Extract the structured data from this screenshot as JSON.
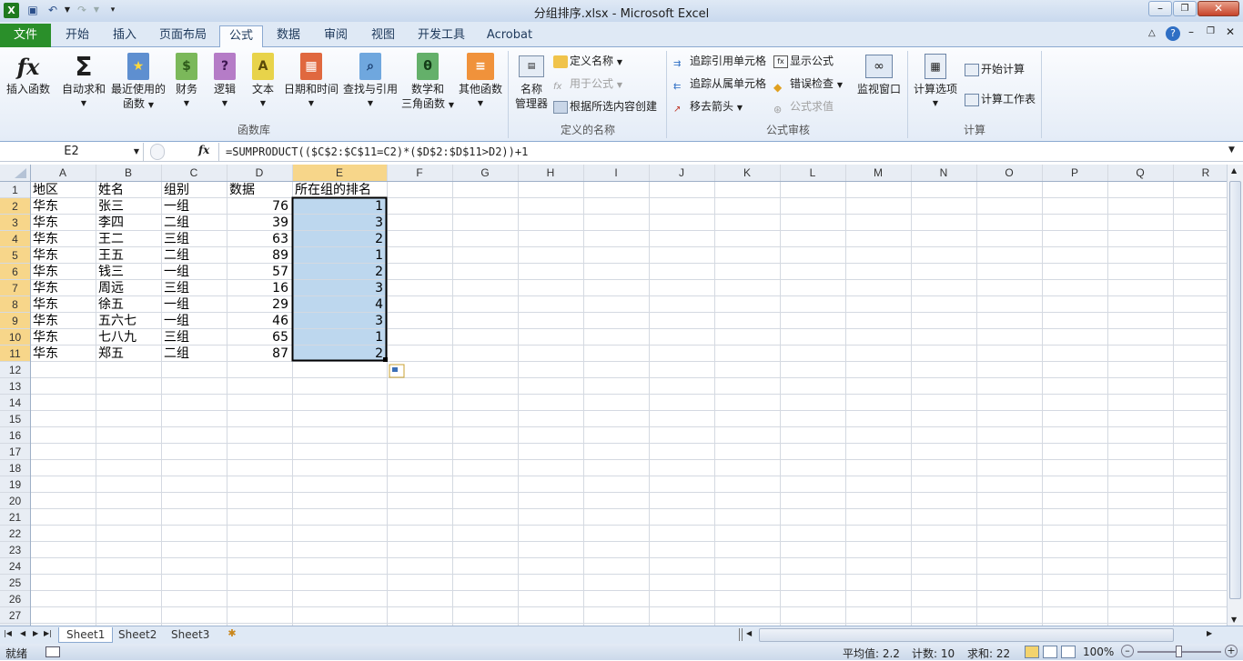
{
  "window": {
    "title": "分组排序.xlsx  -  Microsoft Excel"
  },
  "ribbon_tabs": [
    {
      "label": "文件"
    },
    {
      "label": "开始"
    },
    {
      "label": "插入"
    },
    {
      "label": "页面布局"
    },
    {
      "label": "公式"
    },
    {
      "label": "数据"
    },
    {
      "label": "审阅"
    },
    {
      "label": "视图"
    },
    {
      "label": "开发工具"
    },
    {
      "label": "Acrobat"
    }
  ],
  "ribbon": {
    "function_library": {
      "group_label": "函数库",
      "insert_function": "插入函数",
      "autosum": "自动求和",
      "recent_line1": "最近使用的",
      "recent_line2": "函数",
      "financial": "财务",
      "logical": "逻辑",
      "text": "文本",
      "datetime": "日期和时间",
      "lookup": "查找与引用",
      "math_line1": "数学和",
      "math_line2": "三角函数",
      "more": "其他函数"
    },
    "defined_names": {
      "group_label": "定义的名称",
      "name_manager_line1": "名称",
      "name_manager_line2": "管理器",
      "define_name": "定义名称",
      "use_in_formula": "用于公式",
      "create_from_selection": "根据所选内容创建"
    },
    "formula_auditing": {
      "group_label": "公式审核",
      "trace_precedents": "追踪引用单元格",
      "trace_dependents": "追踪从属单元格",
      "remove_arrows": "移去箭头",
      "show_formulas": "显示公式",
      "error_checking": "错误检查",
      "evaluate_formula": "公式求值",
      "watch_window": "监视窗口"
    },
    "calculation": {
      "group_label": "计算",
      "calc_options": "计算选项",
      "calc_now": "开始计算",
      "calc_sheet": "计算工作表"
    }
  },
  "formula_bar": {
    "name_box": "E2",
    "fx": "fx",
    "formula": "=SUMPRODUCT(($C$2:$C$11=C2)*($D$2:$D$11>D2))+1"
  },
  "columns": [
    "A",
    "B",
    "C",
    "D",
    "E",
    "F",
    "G",
    "H",
    "I",
    "J",
    "K",
    "L",
    "M",
    "N",
    "O",
    "P",
    "Q",
    "R"
  ],
  "row_numbers": [
    "1",
    "2",
    "3",
    "4",
    "5",
    "6",
    "7",
    "8",
    "9",
    "10",
    "11",
    "12",
    "13",
    "14",
    "15",
    "16",
    "17",
    "18",
    "19",
    "20",
    "21",
    "22",
    "23",
    "24",
    "25",
    "26",
    "27"
  ],
  "cells": {
    "header": [
      "地区",
      "姓名",
      "组别",
      "数据",
      "所在组的排名"
    ],
    "rows": [
      [
        "华东",
        "张三",
        "一组",
        "76",
        "1"
      ],
      [
        "华东",
        "李四",
        "二组",
        "39",
        "3"
      ],
      [
        "华东",
        "王二",
        "三组",
        "63",
        "2"
      ],
      [
        "华东",
        "王五",
        "二组",
        "89",
        "1"
      ],
      [
        "华东",
        "钱三",
        "一组",
        "57",
        "2"
      ],
      [
        "华东",
        "周远",
        "三组",
        "16",
        "3"
      ],
      [
        "华东",
        "徐五",
        "一组",
        "29",
        "4"
      ],
      [
        "华东",
        "五六七",
        "一组",
        "46",
        "3"
      ],
      [
        "华东",
        "七八九",
        "三组",
        "65",
        "1"
      ],
      [
        "华东",
        "郑五",
        "二组",
        "87",
        "2"
      ]
    ]
  },
  "sheets": [
    "Sheet1",
    "Sheet2",
    "Sheet3"
  ],
  "status": {
    "ready": "就绪",
    "average": "平均值: 2.2",
    "count": "计数: 10",
    "sum": "求和: 22",
    "zoom": "100%"
  },
  "colors": {
    "accent": "#2a8f2a",
    "selection": "#bdd7ee"
  }
}
